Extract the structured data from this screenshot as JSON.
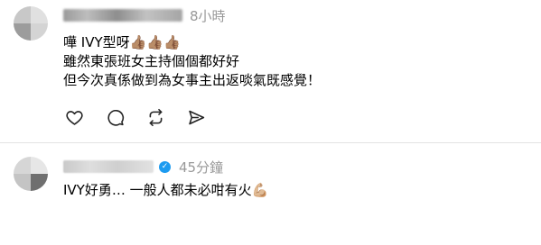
{
  "comments": [
    {
      "username": "",
      "time": "8小時",
      "lines": [
        "嘩 IVY型呀👍🏽👍🏽👍🏽",
        "雖然東張班女主持個個都好好",
        "但今次真係做到為女事主出返啖氣既感覺！"
      ],
      "actions": [
        "heart-icon",
        "comment-icon",
        "repost-icon",
        "share-icon"
      ]
    },
    {
      "username": "",
      "verified": true,
      "time": "45分鐘",
      "lines": [
        "IVY好勇… 一般人都未必咁有火💪🏼"
      ]
    }
  ]
}
